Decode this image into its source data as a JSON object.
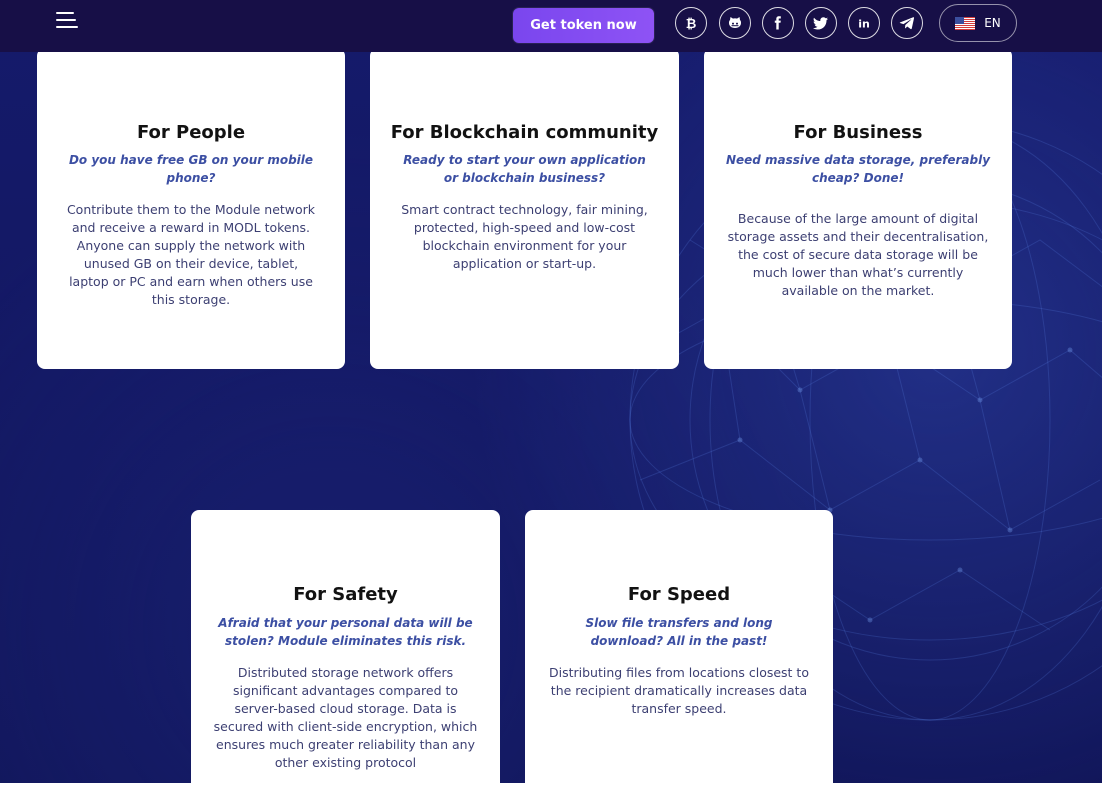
{
  "header": {
    "token_button_label": "Get token now",
    "socials": [
      {
        "name": "bitcoin-icon"
      },
      {
        "name": "github-icon"
      },
      {
        "name": "facebook-icon"
      },
      {
        "name": "twitter-icon"
      },
      {
        "name": "linkedin-icon"
      },
      {
        "name": "telegram-icon"
      }
    ],
    "language": "EN"
  },
  "cards": [
    {
      "title": "For People",
      "subtitle": "Do you have free GB on your mobile phone?",
      "body": "Contribute them to the Module network and receive a reward in MODL tokens. Anyone can supply the network with unused GB on their device, tablet, laptop or PC and earn when others use this storage."
    },
    {
      "title": "For Blockchain community",
      "subtitle": "Ready to start your own application or blockchain business?",
      "body": "Smart contract technology, fair mining, protected, high-speed and low-cost blockchain environment for your application or start-up."
    },
    {
      "title": "For Business",
      "subtitle": "Need massive data storage, preferably cheap? Done!",
      "body": "Because of the large amount of digital storage assets and their decentralisation, the cost of secure data storage will be much lower than what’s currently available on the market."
    },
    {
      "title": "For Safety",
      "subtitle": "Afraid that your personal data will be stolen? Module eliminates this risk.",
      "body": "Distributed storage network offers significant advantages compared to server-based cloud storage. Data is secured with client-side encryption, which ensures much greater reliability than any other existing protocol"
    },
    {
      "title": "For Speed",
      "subtitle": "Slow file transfers and long download? All in the past!",
      "body": "Distributing files from locations closest to the recipient dramatically increases data transfer speed."
    }
  ],
  "colors": {
    "page_background": "#12165e",
    "header_background": "#170f47",
    "accent": "#8a50f3",
    "subtitle": "#3c4fa3",
    "body_text": "#3c3f72"
  }
}
